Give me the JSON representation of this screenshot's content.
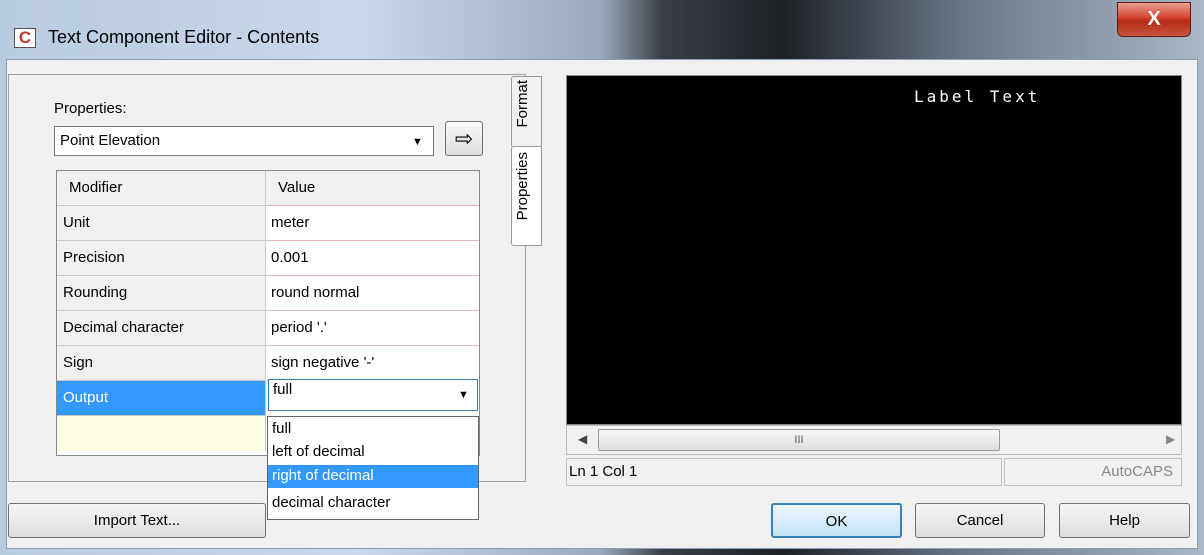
{
  "window": {
    "title": "Text Component Editor - Contents",
    "close_glyph": "X"
  },
  "properties": {
    "label": "Properties:",
    "selected": "Point Elevation",
    "combo_arrow": "▼",
    "insert_arrow": "⇨"
  },
  "grid": {
    "headers": [
      "Modifier",
      "Value"
    ],
    "rows": [
      {
        "modifier": "Unit",
        "value": "meter"
      },
      {
        "modifier": "Precision",
        "value": "0.001"
      },
      {
        "modifier": "Rounding",
        "value": "round normal"
      },
      {
        "modifier": "Decimal character",
        "value": "period '.'"
      },
      {
        "modifier": "Sign",
        "value": "sign negative '-'"
      },
      {
        "modifier": "Output",
        "value": "full"
      }
    ],
    "selected_row": "Output"
  },
  "output_dropdown": {
    "current": "full",
    "arrow": "▼",
    "options": [
      "full",
      "left of decimal",
      "right of decimal",
      "decimal character"
    ],
    "highlighted": "right of decimal"
  },
  "tabs": {
    "format": "Format",
    "properties": "Properties"
  },
  "preview": {
    "label_text": "Label Text",
    "scroll_left": "◀",
    "scroll_right": "▶",
    "thumb_grip": "III",
    "status_position": "Ln 1 Col 1",
    "status_app": "AutoCAPS"
  },
  "buttons": {
    "import": "Import Text...",
    "ok": "OK",
    "cancel": "Cancel",
    "help": "Help"
  },
  "colors": {
    "selection": "#3399ff",
    "preview_bg": "#000000",
    "close": "#c8402b"
  }
}
